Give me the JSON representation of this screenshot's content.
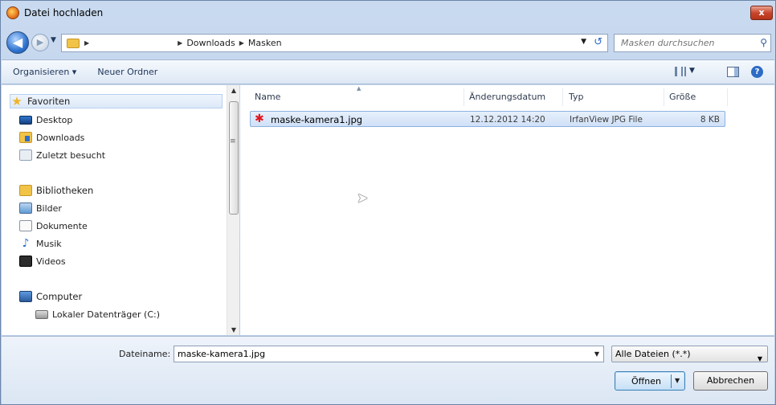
{
  "window": {
    "title": "Datei hochladen",
    "close_label": "x"
  },
  "address": {
    "breadcrumbs": [
      "Downloads",
      "Masken"
    ],
    "search_placeholder": "Masken durchsuchen"
  },
  "toolbar": {
    "organize_label": "Organisieren ▾",
    "new_folder_label": "Neuer Ordner"
  },
  "sidebar": {
    "favorites": {
      "label": "Favoriten",
      "items": [
        "Desktop",
        "Downloads",
        "Zuletzt besucht"
      ]
    },
    "libraries": {
      "label": "Bibliotheken",
      "items": [
        "Bilder",
        "Dokumente",
        "Musik",
        "Videos"
      ]
    },
    "computer": {
      "label": "Computer",
      "items": [
        "Lokaler Datenträger (C:)"
      ]
    }
  },
  "filelist": {
    "columns": [
      "Name",
      "Änderungsdatum",
      "Typ",
      "Größe"
    ],
    "files": [
      {
        "name": "maske-kamera1.jpg",
        "date": "12.12.2012 14:20",
        "type": "IrfanView JPG File",
        "size": "8 KB",
        "icon": "irfanview-image-icon"
      }
    ]
  },
  "footer": {
    "filename_label": "Dateiname:",
    "filename_value": "maske-kamera1.jpg",
    "filter_value": "Alle Dateien (*.*)",
    "open_label": "Öffnen",
    "cancel_label": "Abbrechen"
  },
  "colors": {
    "accent": "#2e6bc4",
    "selection": "#cfe0f7",
    "close": "#c9462e"
  }
}
